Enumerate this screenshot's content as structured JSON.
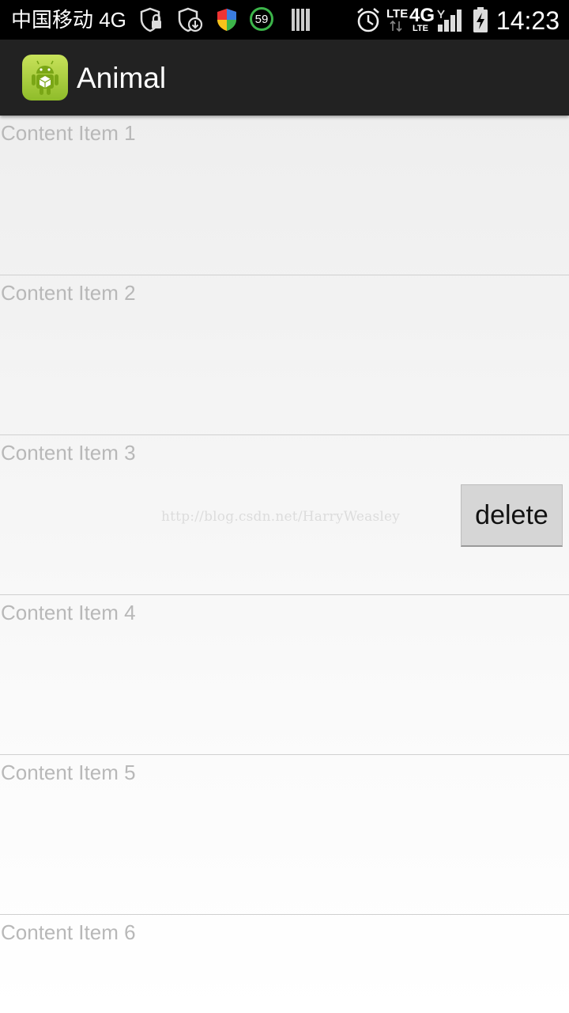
{
  "status_bar": {
    "carrier": "中国移动 4G",
    "battery_badge": "59",
    "network_lte_1": "LTE",
    "network_4g": "4G",
    "network_lte_2": "LTE",
    "time": "14:23"
  },
  "action_bar": {
    "title": "Animal",
    "icon": "android-app-icon"
  },
  "list": {
    "items": [
      {
        "label": "Content Item 1"
      },
      {
        "label": "Content Item 2"
      },
      {
        "label": "Content Item 3",
        "watermark": "http://blog.csdn.net/HarryWeasley",
        "action": "delete"
      },
      {
        "label": "Content Item 4"
      },
      {
        "label": "Content Item 5"
      },
      {
        "label": "Content Item 6"
      }
    ]
  },
  "colors": {
    "status_bar": "#000000",
    "action_bar": "#222222",
    "item_text": "#b8b8b8",
    "button_bg": "#d6d6d6"
  }
}
